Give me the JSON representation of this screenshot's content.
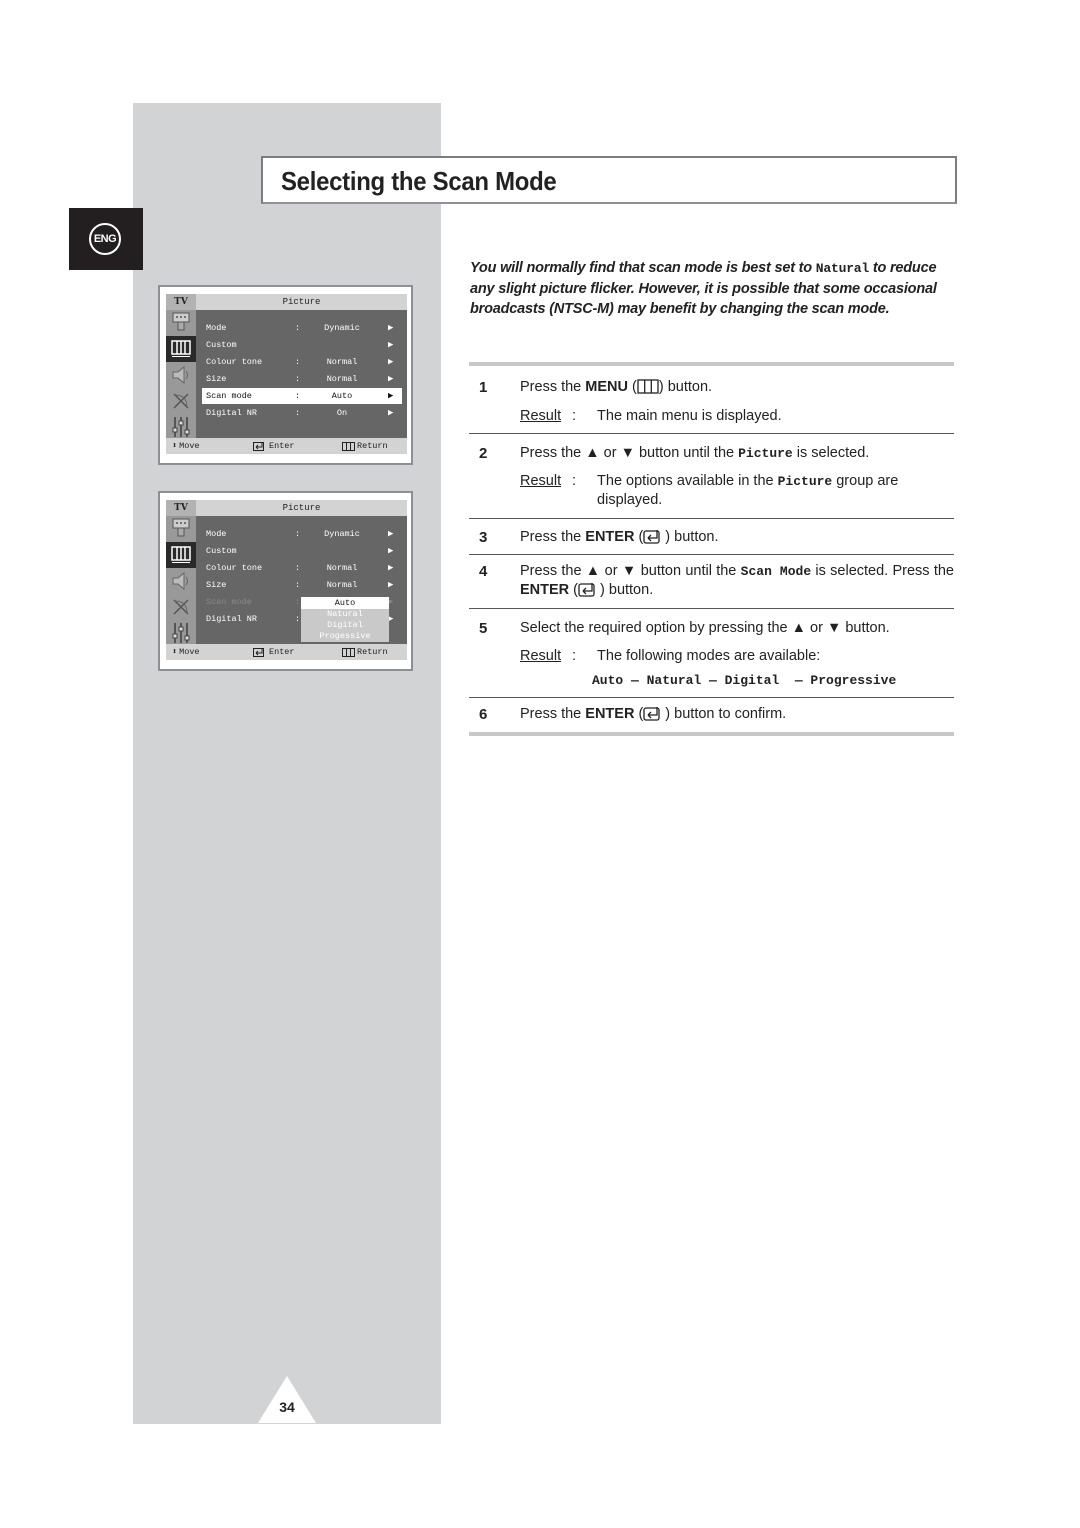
{
  "page": {
    "title": "Selecting the Scan Mode",
    "language_badge": "ENG",
    "page_number": "34"
  },
  "osd_common": {
    "tv_label": "TV",
    "menu_title": "Picture",
    "footer": {
      "move": "Move",
      "enter": "Enter",
      "return": "Return"
    },
    "side_icons": [
      "input-icon",
      "picture-icon",
      "sound-icon",
      "channel-icon",
      "setup-icon"
    ],
    "active_side_icon": "picture-icon"
  },
  "osd1": {
    "rows": [
      {
        "label": "Mode",
        "colon": ":",
        "value": "Dynamic",
        "arrow": "▶"
      },
      {
        "label": "Custom",
        "colon": "",
        "value": "",
        "arrow": "▶"
      },
      {
        "label": "Colour tone",
        "colon": ":",
        "value": "Normal",
        "arrow": "▶"
      },
      {
        "label": "Size",
        "colon": ":",
        "value": "Normal",
        "arrow": "▶"
      },
      {
        "label": "Scan mode",
        "colon": ":",
        "value": "Auto",
        "arrow": "▶"
      },
      {
        "label": "Digital NR",
        "colon": ":",
        "value": "On",
        "arrow": "▶"
      }
    ],
    "selected_row": "Scan mode"
  },
  "osd2": {
    "rows": [
      {
        "label": "Mode",
        "colon": ":",
        "value": "Dynamic",
        "arrow": "▶"
      },
      {
        "label": "Custom",
        "colon": "",
        "value": "",
        "arrow": "▶"
      },
      {
        "label": "Colour tone",
        "colon": ":",
        "value": "Normal",
        "arrow": "▶"
      },
      {
        "label": "Size",
        "colon": ":",
        "value": "Normal",
        "arrow": "▶"
      },
      {
        "label": "Scan mode",
        "colon": ":",
        "value": "",
        "arrow": "▶"
      },
      {
        "label": "Digital NR",
        "colon": ":",
        "value": "",
        "arrow": "▶"
      }
    ],
    "dropdown_options": [
      "Auto",
      "Natural",
      "Digital",
      "Progessive"
    ],
    "dropdown_selected": "Auto"
  },
  "intro": {
    "part1": "You will normally find that scan mode is best set to ",
    "mono": "Natural",
    "part2": " to reduce any slight picture flicker. However, it is possible that some occasional broadcasts (NTSC-M) may benefit by changing the scan mode."
  },
  "result_label": "Result",
  "steps": [
    {
      "num": "1",
      "pre": "Press the ",
      "bold": "MENU",
      "post": " button.",
      "icon": "menu-icon",
      "result": "The main menu is displayed."
    },
    {
      "num": "2",
      "pre": "Press the ▲ or ▼ button until the ",
      "mono": "Picture",
      "post": " is selected.",
      "result_pre": "The options available in the ",
      "result_mono": "Picture",
      "result_post": " group are displayed."
    },
    {
      "num": "3",
      "pre": "Press the ",
      "bold": "ENTER",
      "post": " button.",
      "icon": "enter-icon"
    },
    {
      "num": "4",
      "pre": "Press the ▲ or ▼ button until the ",
      "mono": "Scan Mode",
      "mid": " is selected. Press the ",
      "bold": "ENTER",
      "post": " button.",
      "icon": "enter-icon"
    },
    {
      "num": "5",
      "pre": "Select the required option by pressing the ▲ or ▼ button.",
      "result": "The following modes are available:",
      "modes": "Auto — Natural — Digital  — Progressive"
    },
    {
      "num": "6",
      "pre": "Press the ",
      "bold": "ENTER",
      "post": " button to confirm.",
      "icon": "enter-icon"
    }
  ]
}
